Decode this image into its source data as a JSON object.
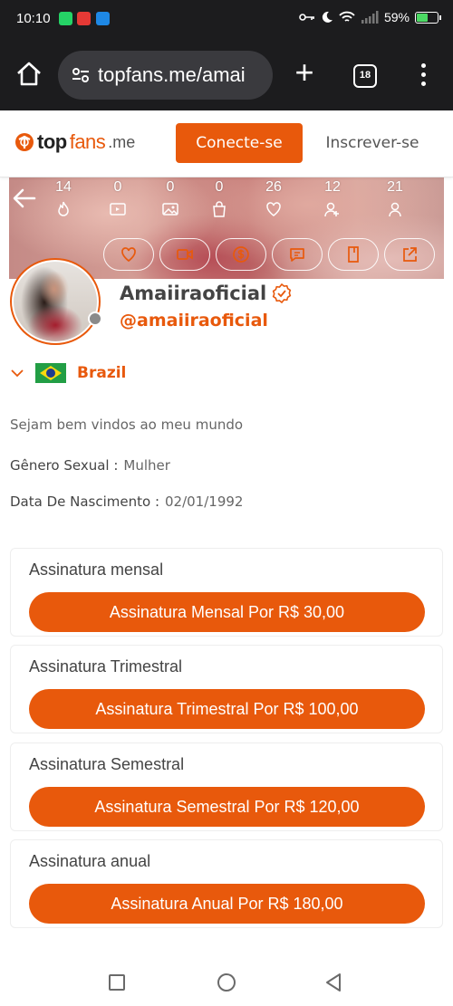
{
  "status_bar": {
    "time": "10:10",
    "battery": "59%",
    "battery_level": 0.59
  },
  "browser": {
    "url": "topfans.me/amai",
    "tab_count": "18"
  },
  "header": {
    "logo_top": "top",
    "logo_fans": "fans",
    "logo_suffix": ".me",
    "connect_label": "Conecte-se",
    "register_label": "Inscrever-se"
  },
  "stats": [
    {
      "value": "14",
      "icon": "flame-icon"
    },
    {
      "value": "0",
      "icon": "video-icon"
    },
    {
      "value": "0",
      "icon": "image-icon"
    },
    {
      "value": "0",
      "icon": "bag-icon"
    },
    {
      "value": "26",
      "icon": "heart-icon"
    },
    {
      "value": "12",
      "icon": "user-plus-icon"
    },
    {
      "value": "21",
      "icon": "user-icon"
    }
  ],
  "action_buttons": [
    "heart-icon",
    "video-call-icon",
    "dollar-icon",
    "message-icon",
    "bookmark-icon",
    "share-icon"
  ],
  "profile": {
    "name": "Amaiiraoficial",
    "handle": "@amaiiraoficial",
    "country": "Brazil",
    "bio": "Sejam bem vindos ao meu mundo",
    "gender_label": "Gênero Sexual :",
    "gender_value": "Mulher",
    "birth_label": "Data De Nascimento :",
    "birth_value": "02/01/1992"
  },
  "subscriptions": [
    {
      "title": "Assinatura mensal",
      "button": "Assinatura Mensal Por R$ 30,00"
    },
    {
      "title": "Assinatura Trimestral",
      "button": "Assinatura Trimestral Por R$ 100,00"
    },
    {
      "title": "Assinatura Semestral",
      "button": "Assinatura Semestral Por R$ 120,00"
    },
    {
      "title": "Assinatura anual",
      "button": "Assinatura Anual Por R$ 180,00"
    }
  ],
  "colors": {
    "accent": "#e8590c",
    "dark_bar": "#1c1c1e",
    "battery": "#4cd964"
  }
}
